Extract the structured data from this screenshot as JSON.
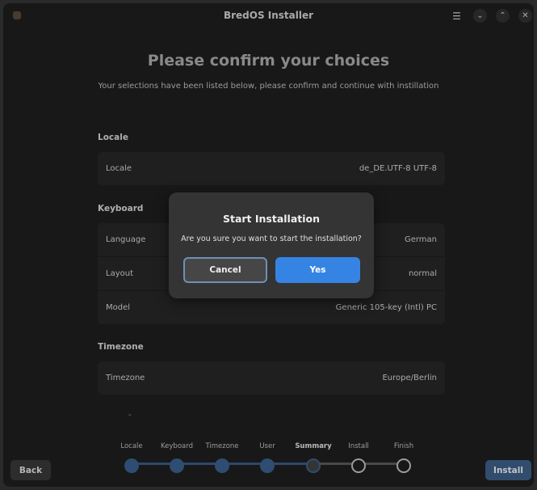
{
  "window": {
    "title": "BredOS Installer",
    "menu_icon": "☰",
    "minimize_icon": "⌄",
    "maximize_icon": "⌃",
    "close_icon": "✕"
  },
  "header": {
    "title": "Please confirm your choices",
    "subtitle": "Your selections have been listed below, please confirm and continue with instillation"
  },
  "sections": {
    "locale": {
      "title": "Locale",
      "rows": [
        {
          "label": "Locale",
          "value": "de_DE.UTF-8 UTF-8"
        }
      ]
    },
    "keyboard": {
      "title": "Keyboard",
      "rows": [
        {
          "label": "Language",
          "value": "German"
        },
        {
          "label": "Layout",
          "value": "normal"
        },
        {
          "label": "Model",
          "value": "Generic 105-key (Intl) PC"
        }
      ]
    },
    "timezone": {
      "title": "Timezone",
      "rows": [
        {
          "label": "Timezone",
          "value": "Europe/Berlin"
        }
      ]
    },
    "extra": "-"
  },
  "footer": {
    "back_label": "Back",
    "install_label": "Install"
  },
  "steps": [
    {
      "label": "Locale",
      "state": "done"
    },
    {
      "label": "Keyboard",
      "state": "done"
    },
    {
      "label": "Timezone",
      "state": "done"
    },
    {
      "label": "User",
      "state": "done"
    },
    {
      "label": "Summary",
      "state": "current"
    },
    {
      "label": "Install",
      "state": "todo"
    },
    {
      "label": "Finish",
      "state": "todo"
    }
  ],
  "dialog": {
    "title": "Start Installation",
    "message": "Are you sure you want to start the installation?",
    "cancel_label": "Cancel",
    "yes_label": "Yes"
  },
  "colors": {
    "accent": "#3584e4",
    "step_done": "#3a5f8c",
    "install_button": "#3c5d85"
  }
}
